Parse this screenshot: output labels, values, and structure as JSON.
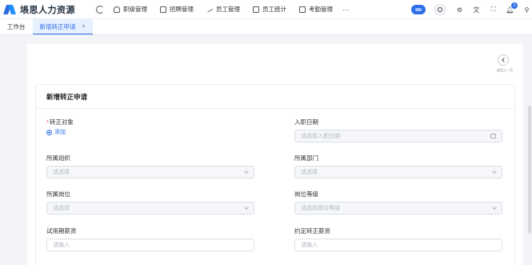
{
  "app": {
    "title": "㙊思人力资源"
  },
  "nav": {
    "items": [
      {
        "label": "职级管理",
        "icon": "hierarchy-icon"
      },
      {
        "label": "招聘管理",
        "icon": "grid-icon"
      },
      {
        "label": "员工管理",
        "icon": "edit-icon"
      },
      {
        "label": "员工统计",
        "icon": "document-icon"
      },
      {
        "label": "考勤管理",
        "icon": "document-icon"
      }
    ],
    "more": "···"
  },
  "header": {
    "notification_count": "1"
  },
  "tabs": [
    {
      "label": "工作台"
    },
    {
      "label": "新增转正申请",
      "close": "×"
    }
  ],
  "page": {
    "back_label": "返回上一页"
  },
  "form": {
    "title": "新增转正申请",
    "fields": {
      "subject": {
        "label": "转正对象",
        "required_mark": "*",
        "add_label": "添加"
      },
      "hire_date": {
        "label": "入职日期",
        "placeholder": "请选择入职日期"
      },
      "organization": {
        "label": "所属组织",
        "placeholder": "请选择"
      },
      "department": {
        "label": "所属部门",
        "placeholder": "请选择"
      },
      "position": {
        "label": "所属岗位",
        "placeholder": "请选择"
      },
      "position_level": {
        "label": "岗位等级",
        "placeholder": "请选择岗位等级"
      },
      "probation_salary": {
        "label": "试用期薪资",
        "placeholder": "请输入"
      },
      "regular_salary": {
        "label": "约定转正薪资",
        "placeholder": "请输入"
      }
    }
  },
  "colors": {
    "primary": "#2f6fe6",
    "required": "#e24a4a",
    "background": "#f3f4f7"
  }
}
